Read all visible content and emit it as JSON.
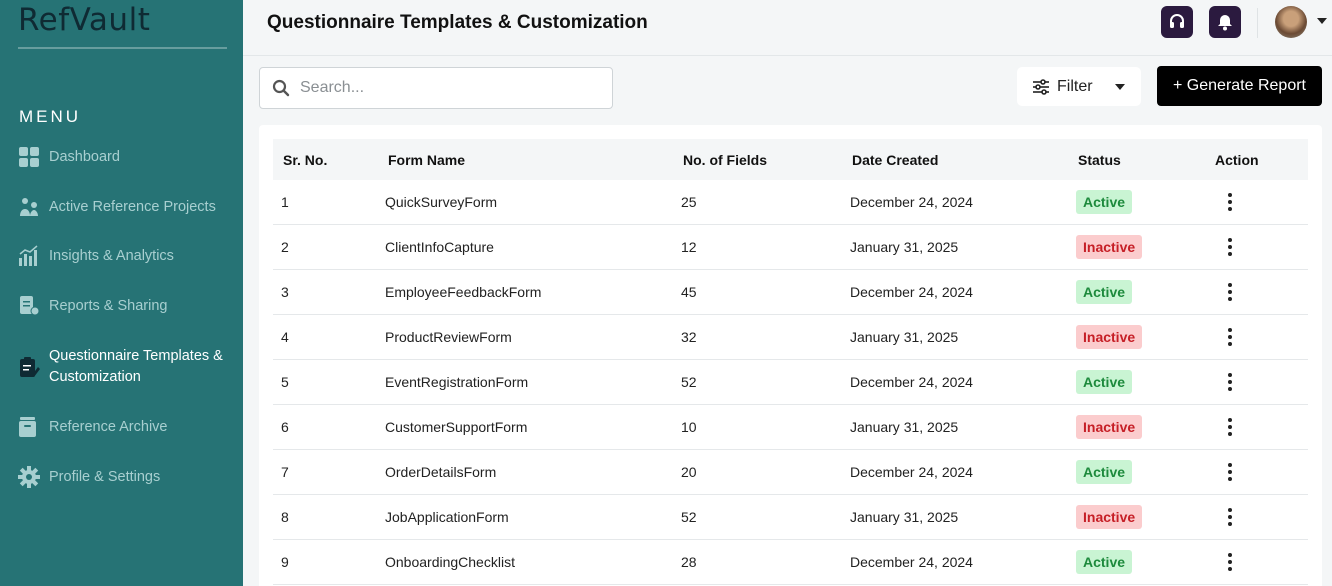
{
  "app": {
    "logo": "RefVault"
  },
  "sidebar": {
    "menu_label": "MENU",
    "items": [
      {
        "label": "Dashboard",
        "icon": "dashboard-grid-icon"
      },
      {
        "label": "Active Reference Projects",
        "icon": "people-network-icon"
      },
      {
        "label": "Insights & Analytics",
        "icon": "bar-chart-icon"
      },
      {
        "label": "Reports & Sharing",
        "icon": "report-share-icon"
      },
      {
        "label": "Questionnaire Templates & Customization",
        "icon": "clipboard-edit-icon",
        "active": true
      },
      {
        "label": "Reference Archive",
        "icon": "archive-box-icon"
      },
      {
        "label": "Profile & Settings",
        "icon": "gear-icon"
      }
    ]
  },
  "header": {
    "title": "Questionnaire Templates & Customization",
    "support_icon": "headset-icon",
    "notification_icon": "bell-icon"
  },
  "toolbar": {
    "search_placeholder": "Search...",
    "filter_label": "Filter",
    "generate_label": "+ Generate Report"
  },
  "table": {
    "columns": [
      "Sr. No.",
      "Form Name",
      "No. of Fields",
      "Date Created",
      "Status",
      "Action"
    ],
    "rows": [
      {
        "sr": "1",
        "name": "QuickSurveyForm",
        "fields": "25",
        "date": "December 24, 2024",
        "status": "Active"
      },
      {
        "sr": "2",
        "name": "ClientInfoCapture",
        "fields": "12",
        "date": "January 31, 2025",
        "status": "Inactive"
      },
      {
        "sr": "3",
        "name": "EmployeeFeedbackForm",
        "fields": "45",
        "date": "December 24, 2024",
        "status": "Active"
      },
      {
        "sr": "4",
        "name": "ProductReviewForm",
        "fields": "32",
        "date": "January 31, 2025",
        "status": "Inactive"
      },
      {
        "sr": "5",
        "name": "EventRegistrationForm",
        "fields": "52",
        "date": "December 24, 2024",
        "status": "Active"
      },
      {
        "sr": "6",
        "name": "CustomerSupportForm",
        "fields": "10",
        "date": "January 31, 2025",
        "status": "Inactive"
      },
      {
        "sr": "7",
        "name": "OrderDetailsForm",
        "fields": "20",
        "date": "December 24, 2024",
        "status": "Active"
      },
      {
        "sr": "8",
        "name": "JobApplicationForm",
        "fields": "52",
        "date": "January 31, 2025",
        "status": "Inactive"
      },
      {
        "sr": "9",
        "name": "OnboardingChecklist",
        "fields": "28",
        "date": "December 24, 2024",
        "status": "Active"
      }
    ]
  },
  "colors": {
    "sidebar_bg": "#267375",
    "active_badge_bg": "#c9f4d3",
    "active_badge_text": "#1d8a3c",
    "inactive_badge_bg": "#fbcccd",
    "inactive_badge_text": "#c61f26",
    "header_button_bg": "#2b1a3f"
  }
}
